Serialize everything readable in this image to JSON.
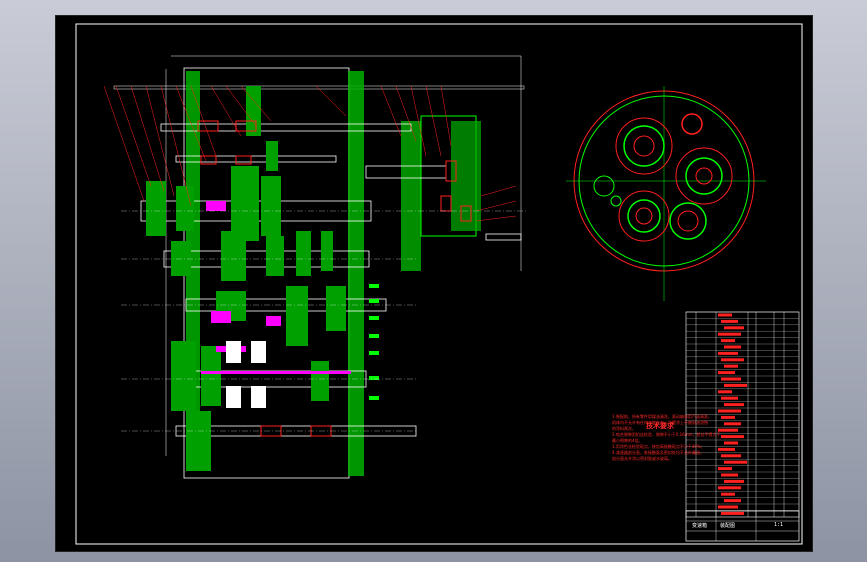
{
  "drawing": {
    "tech_title": "技术要求",
    "tech_notes": [
      "1.装配前，所有零件用煤油清洗，滚动轴承用汽油清洗，",
      "  机体内不允许有任何杂物存在。内壁涂上不被机油浸蚀",
      "  的涂料两次。",
      "2.啮合侧隙用铅丝检验，侧隙不小于0.16mm，铅丝不得大于",
      "  最小侧隙的4倍。",
      "3.用涂色法检验斑点，按齿高接触斑点不少于40%；",
      "4.减速器剖分面，各接触面及密封处均不允许漏油，",
      "  剖分面允许涂以密封胶或水玻璃。"
    ],
    "title_block": {
      "drawing_title": "变速箱",
      "drawing_no": "装配图",
      "scale_label": "1:1"
    }
  },
  "colors": {
    "background": "#000000",
    "green": "#00ff00",
    "red": "#ff2020",
    "white": "#ffffff",
    "magenta": "#ff00ff",
    "yellow": "#ffff00"
  }
}
